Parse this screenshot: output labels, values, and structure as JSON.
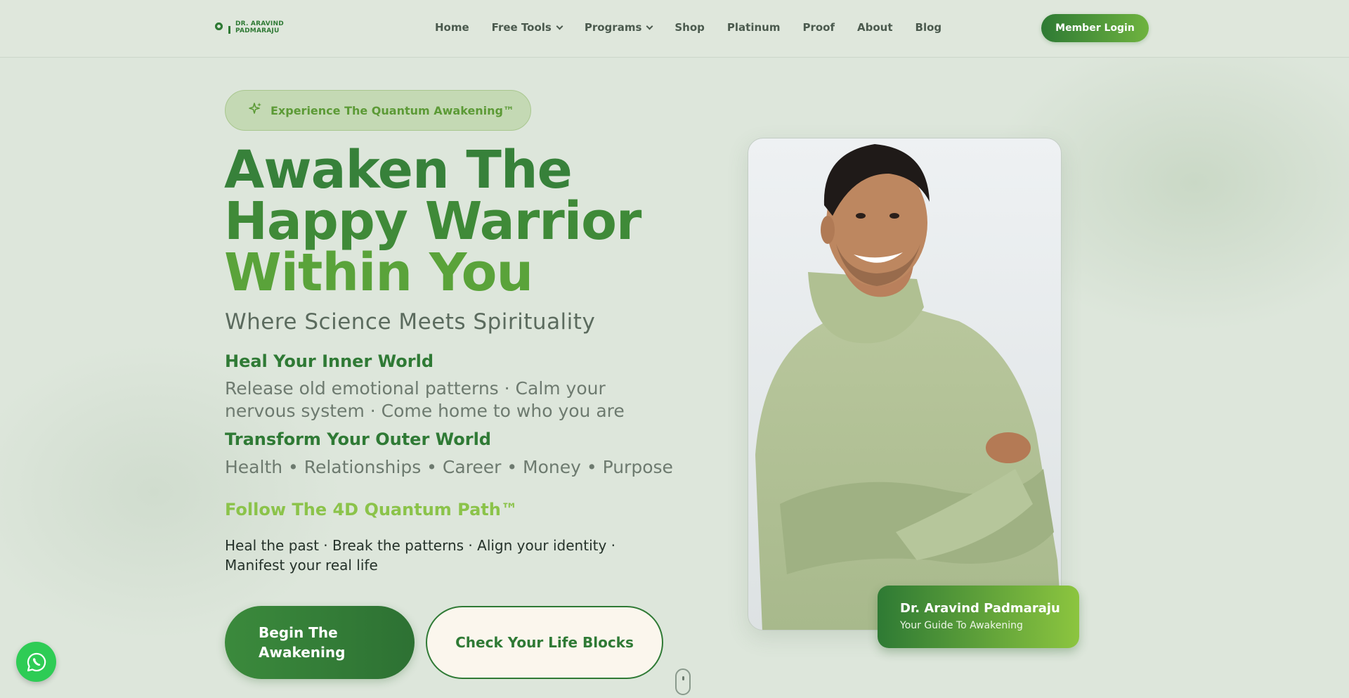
{
  "header": {
    "logo_line1": "DR. ARAVIND",
    "logo_line2": "PADMARAJU",
    "nav": [
      {
        "label": "Home"
      },
      {
        "label": "Free Tools"
      },
      {
        "label": "Programs"
      },
      {
        "label": "Shop"
      },
      {
        "label": "Platinum"
      },
      {
        "label": "Proof"
      },
      {
        "label": "About"
      },
      {
        "label": "Blog"
      }
    ],
    "login_label": "Member Login"
  },
  "hero": {
    "badge": "Experience The Quantum Awakening™",
    "headline_line1": "Awaken The",
    "headline_line2": "Happy Warrior",
    "headline_line3": "Within You",
    "subtitle": "Where Science Meets Spirituality",
    "inner_title": "Heal Your Inner World",
    "inner_body": "Release old emotional patterns · Calm your nervous system · Come home to who you are",
    "outer_title": "Transform Your Outer World",
    "outer_body": "Health • Relationships • Career • Money • Purpose",
    "path_title": "Follow The 4D Quantum Path™",
    "path_body": "Heal the past · Break the patterns · Align your identity · Manifest your real life",
    "cta_primary": "Begin The Awakening",
    "cta_secondary": "Check Your Life Blocks"
  },
  "profile": {
    "name": "Dr. Aravind Padmaraju",
    "role": "Your Guide To Awakening"
  },
  "colors": {
    "accent": "#2f7a35",
    "accent_light": "#8bc34a",
    "background": "#dde6db"
  }
}
